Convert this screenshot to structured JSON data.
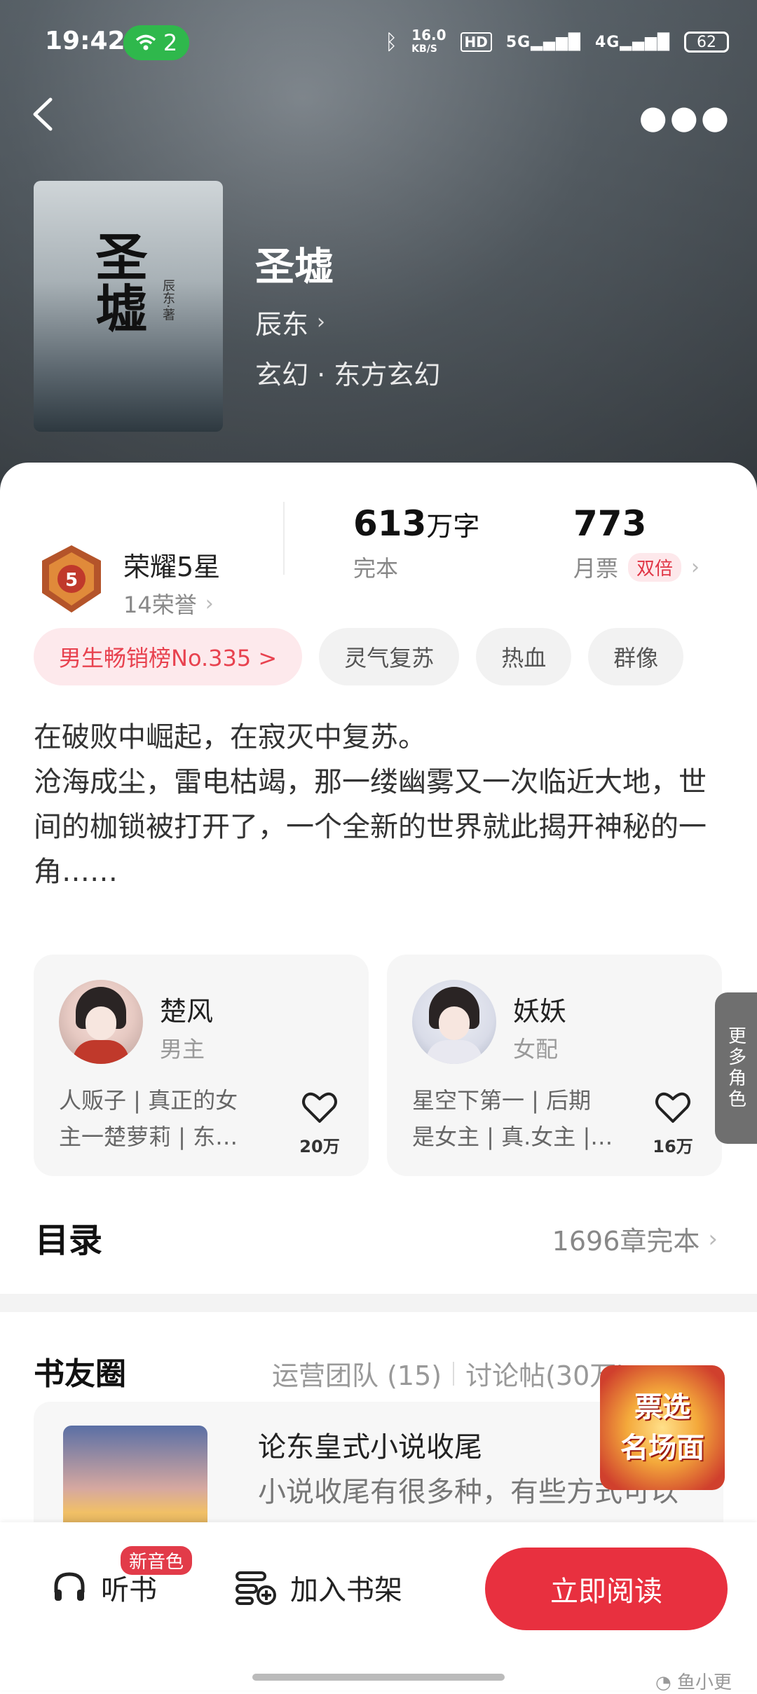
{
  "status": {
    "time": "19:42",
    "wifi_count": "2",
    "speed": "16.0",
    "speed_unit": "KB/S",
    "hd": "HD",
    "sig5g": "5G",
    "sig4g": "4G",
    "battery": "62"
  },
  "cover": {
    "title": "圣墟",
    "author_mark": "辰东·著"
  },
  "book": {
    "title": "圣墟",
    "author": "辰东",
    "genre": "玄幻 · 东方玄幻"
  },
  "honor": {
    "title": "荣耀5星",
    "sub": "14荣誉",
    "badge_num": "5"
  },
  "stats": {
    "words": {
      "value": "613",
      "unit": "万字",
      "label": "完本"
    },
    "tickets": {
      "value": "773",
      "label": "月票",
      "tag": "双倍"
    }
  },
  "tags": [
    {
      "label": "男生畅销榜No.335 >"
    },
    {
      "label": "灵气复苏"
    },
    {
      "label": "热血"
    },
    {
      "label": "群像"
    }
  ],
  "intro": {
    "line1": "在破败中崛起，在寂灭中复苏。",
    "line2": "沧海成尘，雷电枯竭，那一缕幽雾又一次临近大地，世间的枷锁被打开了，一个全新的世界就此揭开神秘的一角……"
  },
  "roles": [
    {
      "name": "楚风",
      "type": "男主",
      "desc1": "人贩子 | 真正的女",
      "desc2": "主一楚萝莉 | 东…",
      "likes": "20万"
    },
    {
      "name": "妖妖",
      "type": "女配",
      "desc1": "星空下第一 | 后期",
      "desc2": "是女主 | 真.女主 |…",
      "likes": "16万"
    }
  ],
  "more_roles": "更多角色",
  "catalog": {
    "title": "目录",
    "meta": "1696章完本"
  },
  "circle": {
    "title": "书友圈",
    "ops": "运营团队 (15)",
    "posts": "讨论帖(30万)",
    "post_title": "论东皇式小说收尾",
    "post_body": "小说收尾有很多种，有些方式可以"
  },
  "promo": {
    "line1": "票选",
    "line2": "名场面"
  },
  "bottom": {
    "listen": "听书",
    "new_voice": "新音色",
    "shelf": "加入书架",
    "read": "立即阅读"
  },
  "watermark": "鱼小更",
  "colors": {
    "accent": "#e8303f",
    "wifi": "#2fb84c",
    "tag_bg": "#f2f2f2"
  }
}
